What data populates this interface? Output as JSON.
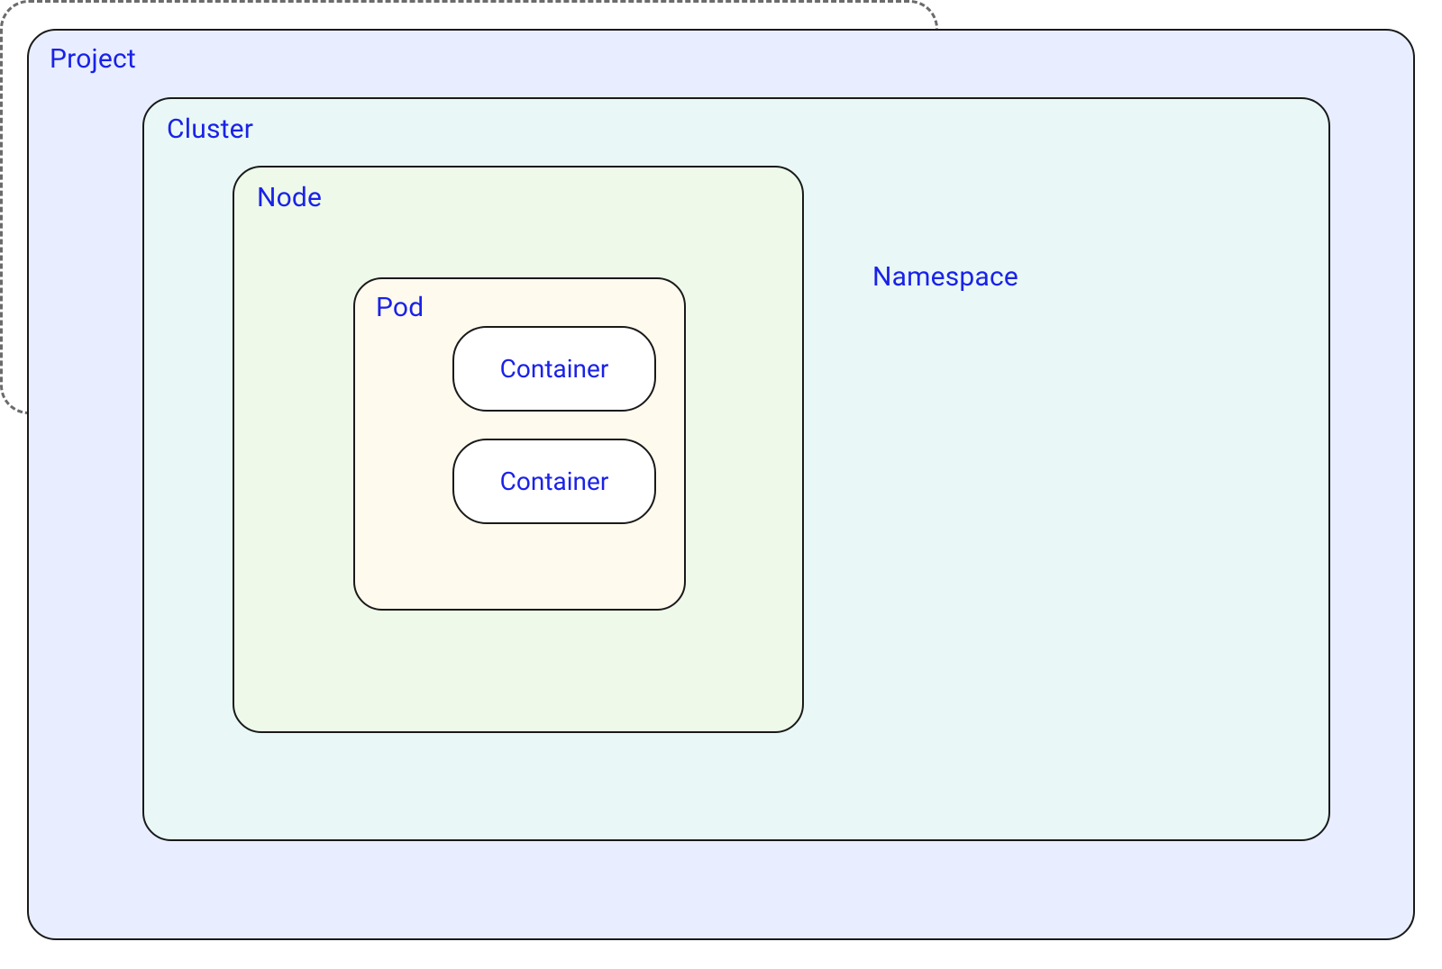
{
  "diagram": {
    "project": {
      "label": "Project"
    },
    "cluster": {
      "label": "Cluster"
    },
    "node": {
      "label": "Node"
    },
    "namespace": {
      "label": "Namespace"
    },
    "pod": {
      "label": "Pod"
    },
    "container1": {
      "label": "Container"
    },
    "container2": {
      "label": "Container"
    }
  },
  "colors": {
    "label_text": "#1a22e8",
    "border": "#1a1a1a",
    "project_fill": "#e8eeff",
    "cluster_fill": "#e9f8f6",
    "node_fill": "#eef9ea",
    "pod_fill": "#fffaee",
    "container_fill": "#ffffff",
    "namespace_border": "#6b6b6b"
  }
}
